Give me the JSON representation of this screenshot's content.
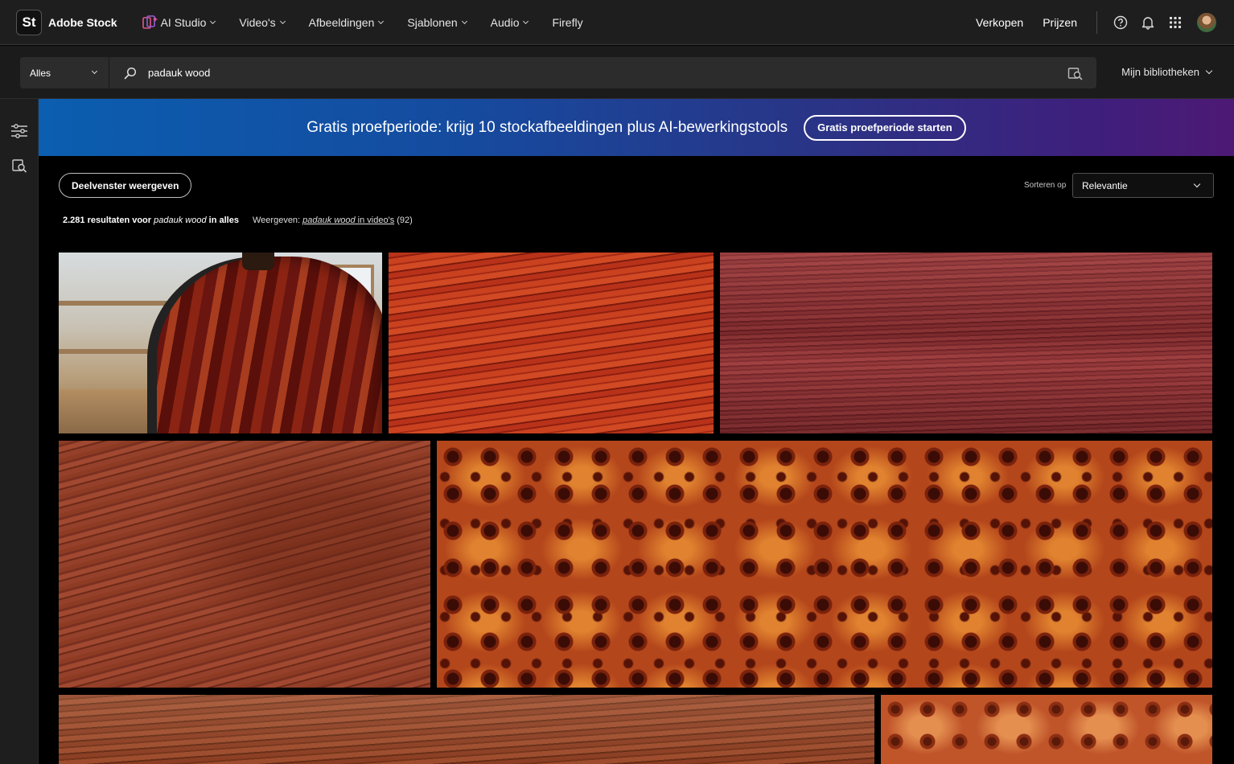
{
  "app": {
    "logo_text": "St",
    "name": "Adobe Stock"
  },
  "nav": {
    "items": [
      {
        "label": "AI Studio",
        "has_menu": true
      },
      {
        "label": "Video's",
        "has_menu": true
      },
      {
        "label": "Afbeeldingen",
        "has_menu": true
      },
      {
        "label": "Sjablonen",
        "has_menu": true
      },
      {
        "label": "Audio",
        "has_menu": true
      },
      {
        "label": "Firefly",
        "has_menu": false
      }
    ],
    "sell": "Verkopen",
    "pricing": "Prijzen",
    "icons": [
      "help-icon",
      "bell-icon",
      "apps-grid-icon",
      "avatar"
    ]
  },
  "search": {
    "scope": "Alles",
    "query": "padauk wood",
    "libraries": "Mijn bibliotheken"
  },
  "banner": {
    "text": "Gratis proefperiode: krijg 10 stockafbeeldingen plus AI-bewerkingstools",
    "button": "Gratis proefperiode starten"
  },
  "toolbar": {
    "panel_button": "Deelvenster weergeven",
    "sort_label": "Sorteren op",
    "sort_value": "Relevantie"
  },
  "results": {
    "count": "2.281",
    "prefix": "resultaten voor",
    "query": "padauk wood",
    "suffix": "in alles",
    "see_label": "Weergeven:",
    "see_query": "padauk wood",
    "see_suffix": " in video's",
    "see_count": "(92)"
  },
  "colors": {
    "topbar": "#1e1e1e",
    "banner_start": "#0b5eb0",
    "banner_end": "#4d1a74",
    "page_bg": "#000000"
  },
  "thumbnails": [
    {
      "subject": "acoustic guitar back in workshop"
    },
    {
      "subject": "red padauk wood grain"
    },
    {
      "subject": "purple-red wood grain texture"
    },
    {
      "subject": "brown wood grain texture"
    },
    {
      "subject": "burl wood texture"
    },
    {
      "subject": "wood grain texture"
    },
    {
      "subject": "burl wood texture"
    }
  ]
}
